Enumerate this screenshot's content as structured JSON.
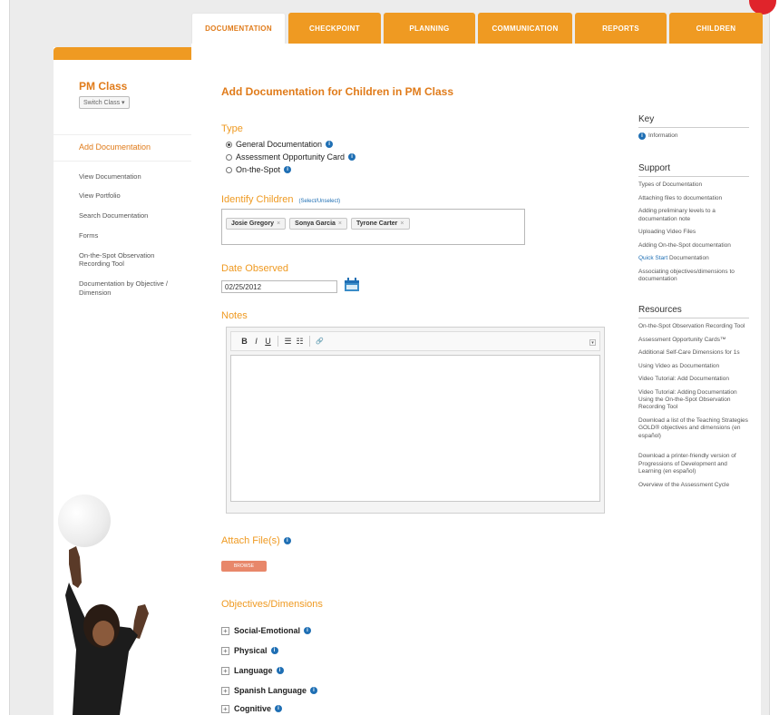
{
  "tabs": [
    "DOCUMENTATION",
    "CHECKPOINT",
    "PLANNING",
    "COMMUNICATION",
    "REPORTS",
    "CHILDREN"
  ],
  "sidebar": {
    "class_title": "PM Class",
    "switch_class": "Switch Class ▾",
    "items": [
      "Add Documentation",
      "View Documentation",
      "View Portfolio",
      "Search Documentation",
      "Forms",
      "On-the-Spot Observation Recording Tool",
      "Documentation by Objective / Dimension"
    ]
  },
  "main": {
    "title": "Add Documentation for Children in PM Class",
    "type_label": "Type",
    "types": [
      "General Documentation",
      "Assessment Opportunity Card",
      "On-the-Spot"
    ],
    "identify_label": "Identify Children",
    "select_link": "(Select/Unselect)",
    "children": [
      "Josie Gregory",
      "Sonya Garcia",
      "Tyrone Carter"
    ],
    "date_label": "Date Observed",
    "date_value": "02/25/2012",
    "notes_label": "Notes",
    "toolbar": [
      "B",
      "I",
      "U",
      "☰",
      "☷",
      "🔗"
    ],
    "attach_label": "Attach File(s)",
    "attach_button": "BROWSE",
    "objectives_label": "Objectives/Dimensions",
    "objectives": [
      "Social-Emotional",
      "Physical",
      "Language",
      "Spanish Language",
      "Cognitive"
    ]
  },
  "right": {
    "key_title": "Key",
    "key_info": "Information",
    "support_title": "Support",
    "support_links": [
      "Types of Documentation",
      "Attaching files to documentation",
      "Adding preliminary levels to a documentation note",
      "Uploading Video Files",
      "Adding On-the-Spot documentation",
      "Quick Start Documentation",
      "Associating objectives/dimensions to documentation"
    ],
    "resources_title": "Resources",
    "resources_links": [
      "On-the-Spot Observation Recording Tool",
      "Assessment Opportunity Cards™",
      "Additional Self-Care Dimensions for 1s",
      "Using Video as Documentation",
      "Video Tutorial: Add Documentation",
      "Video Tutorial: Adding Documentation Using the On-the-Spot Observation Recording Tool",
      "Download a list of the Teaching Strategies GOLD® objectives and dimensions (en español)",
      "Download a printer-friendly version of Progressions of Development and Learning (en español)",
      "Overview of the Assessment Cycle"
    ]
  }
}
